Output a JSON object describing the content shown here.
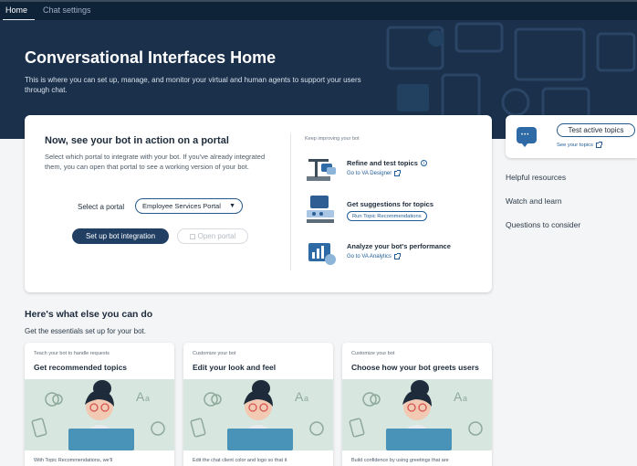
{
  "tabs": [
    {
      "label": "Home",
      "active": true
    },
    {
      "label": "Chat settings",
      "active": false
    }
  ],
  "hero": {
    "title": "Conversational Interfaces Home",
    "subtitle": "This is where you can set up, manage, and monitor your virtual and human agents to support your users through chat."
  },
  "main_card": {
    "title": "Now, see your bot in action on a portal",
    "description": "Select which portal to integrate with your bot. If you've already integrated them, you can open that portal to see a working version of your bot.",
    "portal_label": "Select a portal",
    "portal_value": "Employee Services Portal",
    "setup_button": "Set up bot integration",
    "open_button": "Open portal",
    "keep_improving": "Keep improving your bot",
    "items": [
      {
        "title": "Refine and test topics",
        "link": "Go to VA Designer"
      },
      {
        "title": "Get suggestions for topics",
        "link": "Run Topic Recommendations"
      },
      {
        "title": "Analyze your bot's performance",
        "link": "Go to VA Analytics"
      }
    ]
  },
  "side_panel": {
    "test_button": "Test active topics",
    "see_link": "See your topics",
    "links": [
      "Helpful resources",
      "Watch and learn",
      "Questions to consider"
    ]
  },
  "section": {
    "title": "Here's what else you can do",
    "subtitle": "Get the essentials set up for your bot."
  },
  "feature_cards": [
    {
      "eyebrow": "Teach your bot to handle requests",
      "title": "Get recommended topics",
      "desc": "With Topic Recommendations, we'll"
    },
    {
      "eyebrow": "Customize your bot",
      "title": "Edit your look and feel",
      "desc": "Edit the chat client color and logo so that it"
    },
    {
      "eyebrow": "Customize your bot",
      "title": "Choose how your bot greets users",
      "desc": "Build confidence by using greetings that are"
    }
  ],
  "colors": {
    "hero_bg": "#1a304b",
    "primary_button": "#213f63",
    "link": "#1f5c97",
    "illustration_bg": "#d7e6df"
  }
}
